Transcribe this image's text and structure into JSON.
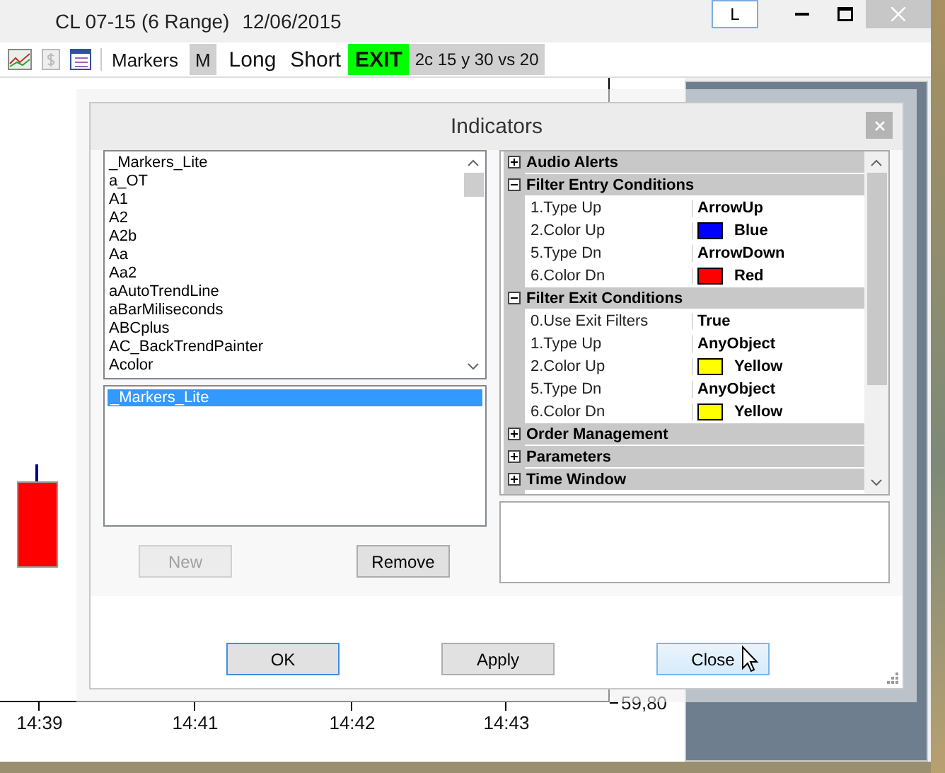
{
  "window": {
    "symbol": "CL 07-15 (6 Range)",
    "date": "12/06/2015",
    "l_button": "L"
  },
  "toolbar": [
    {
      "label": "Markers",
      "kind": "plain"
    },
    {
      "label": "M",
      "kind": "gray"
    },
    {
      "label": "Long",
      "kind": "large"
    },
    {
      "label": "Short",
      "kind": "large"
    },
    {
      "label": "EXIT",
      "kind": "green"
    },
    {
      "label": "2c 15 y 30 vs 20",
      "kind": "gray"
    }
  ],
  "chart": {
    "time_labels": [
      "14:39",
      "14:41",
      "14:42",
      "14:43"
    ],
    "price_label": "59,80"
  },
  "dialog": {
    "title": "Indicators",
    "available": [
      "_Markers_Lite",
      "a_OT",
      "A1",
      "A2",
      "A2b",
      "Aa",
      "Aa2",
      "aAutoTrendLine",
      "aBarMiliseconds",
      "ABCplus",
      "AC_BackTrendPainter",
      "Acolor"
    ],
    "added": [
      {
        "label": "_Markers_Lite",
        "selected": true
      }
    ],
    "list_buttons": [
      {
        "label": "New",
        "disabled": true
      },
      {
        "label": "Remove",
        "disabled": false
      }
    ],
    "properties": [
      {
        "label": "Audio Alerts",
        "expanded": false
      },
      {
        "label": "Filter Entry Conditions",
        "expanded": true,
        "children": [
          {
            "name": "1.Type Up",
            "value": "ArrowUp"
          },
          {
            "name": "2.Color Up",
            "value": "Blue",
            "color": "#0000ff"
          },
          {
            "name": "5.Type Dn",
            "value": "ArrowDown"
          },
          {
            "name": "6.Color Dn",
            "value": "Red",
            "color": "#ff0000"
          }
        ]
      },
      {
        "label": "Filter Exit Conditions",
        "expanded": true,
        "children": [
          {
            "name": "0.Use Exit Filters",
            "value": "True"
          },
          {
            "name": "1.Type Up",
            "value": "AnyObject"
          },
          {
            "name": "2.Color Up",
            "value": "Yellow",
            "color": "#ffff00"
          },
          {
            "name": "5.Type Dn",
            "value": "AnyObject"
          },
          {
            "name": "6.Color Dn",
            "value": "Yellow",
            "color": "#ffff00"
          }
        ]
      },
      {
        "label": "Order Management",
        "expanded": false
      },
      {
        "label": "Parameters",
        "expanded": false
      },
      {
        "label": "Time Window",
        "expanded": false
      }
    ],
    "buttons": [
      {
        "label": "OK",
        "kind": "default"
      },
      {
        "label": "Apply",
        "kind": "normal"
      },
      {
        "label": "Close",
        "kind": "hover"
      }
    ]
  }
}
